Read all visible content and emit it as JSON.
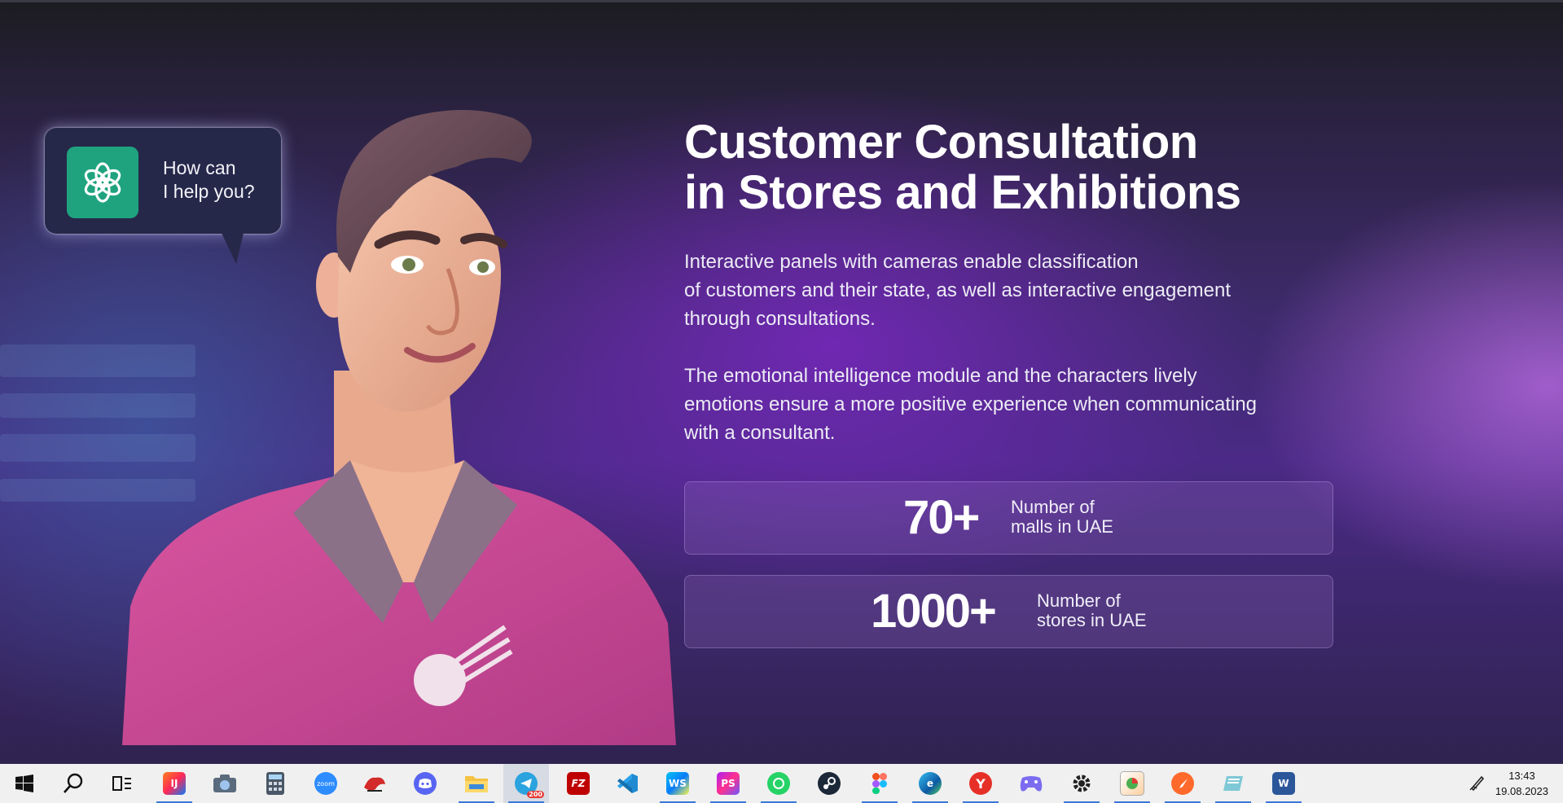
{
  "hero": {
    "bubble_text": [
      "How can",
      "I help you?"
    ],
    "title_lines": [
      "Customer Consultation",
      "in Stores and Exhibitions"
    ],
    "paragraph1": [
      "Interactive panels with cameras enable classification",
      "of customers and their state, as well as interactive engagement",
      "through consultations."
    ],
    "paragraph2": [
      "The emotional intelligence module and the characters lively",
      "emotions ensure a more positive experience when communicating",
      "with a consultant."
    ]
  },
  "stats": [
    {
      "number": "70+",
      "label": [
        "Number of",
        "malls in UAE"
      ]
    },
    {
      "number": "1000+",
      "label": [
        "Number of",
        "stores in UAE"
      ]
    }
  ],
  "taskbar": {
    "items": [
      {
        "name": "start",
        "icon": "windows-icon"
      },
      {
        "name": "search",
        "icon": "search-icon"
      },
      {
        "name": "task-view",
        "icon": "task-view-icon"
      },
      {
        "name": "intellij",
        "icon": "intellij-icon",
        "text": "IJ"
      },
      {
        "name": "camera",
        "icon": "camera-icon"
      },
      {
        "name": "calculator",
        "icon": "calculator-icon"
      },
      {
        "name": "zoom",
        "icon": "zoom-icon",
        "text": "zoom"
      },
      {
        "name": "app-red",
        "icon": "app-icon"
      },
      {
        "name": "discord",
        "icon": "discord-icon"
      },
      {
        "name": "file-explorer",
        "icon": "folder-icon"
      },
      {
        "name": "telegram",
        "icon": "telegram-icon",
        "badge": "200"
      },
      {
        "name": "filezilla",
        "icon": "filezilla-icon",
        "text": "FZ"
      },
      {
        "name": "vscode",
        "icon": "vscode-icon"
      },
      {
        "name": "webstorm",
        "icon": "webstorm-icon",
        "text": "WS"
      },
      {
        "name": "phpstorm",
        "icon": "phpstorm-icon",
        "text": "PS"
      },
      {
        "name": "whatsapp",
        "icon": "whatsapp-icon"
      },
      {
        "name": "steam",
        "icon": "steam-icon"
      },
      {
        "name": "figma",
        "icon": "figma-icon"
      },
      {
        "name": "edge",
        "icon": "edge-icon"
      },
      {
        "name": "yandex",
        "icon": "yandex-browser-icon",
        "text": "Y"
      },
      {
        "name": "game",
        "icon": "gamepad-icon"
      },
      {
        "name": "settings",
        "icon": "gear-icon"
      },
      {
        "name": "app-chart",
        "icon": "chart-app-icon"
      },
      {
        "name": "app-orange",
        "icon": "compass-icon"
      },
      {
        "name": "app-teal",
        "icon": "app-icon"
      },
      {
        "name": "word",
        "icon": "word-icon",
        "text": "W"
      }
    ],
    "clock": {
      "time": "13:43",
      "date": "19.08.2023"
    }
  },
  "colors": {
    "gpt_badge": "#1fa37f",
    "bubble": "#26284a",
    "taskbar": "#f0f0f0"
  }
}
